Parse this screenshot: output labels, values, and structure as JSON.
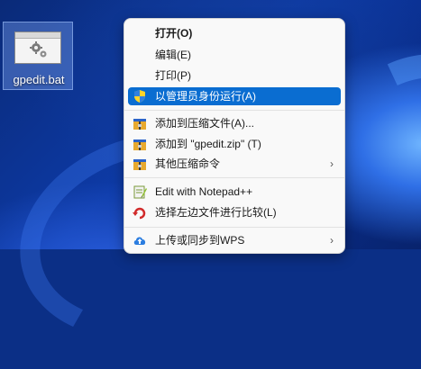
{
  "desktop": {
    "icon_label": "gpedit.bat"
  },
  "menu": {
    "items": [
      {
        "label": "打开(O)",
        "icon": "none"
      },
      {
        "label": "编辑(E)",
        "icon": "none"
      },
      {
        "label": "打印(P)",
        "icon": "none"
      },
      {
        "label": "以管理员身份运行(A)",
        "icon": "uac-shield-icon",
        "highlighted": true
      },
      {
        "label": "添加到压缩文件(A)...",
        "icon": "archive-icon"
      },
      {
        "label": "添加到 \"gpedit.zip\" (T)",
        "icon": "archive-icon"
      },
      {
        "label": "其他压缩命令",
        "icon": "archive-icon",
        "submenu": true
      },
      {
        "label": "Edit with Notepad++",
        "icon": "notepad-plus-plus-icon"
      },
      {
        "label": "选择左边文件进行比较(L)",
        "icon": "compare-icon"
      },
      {
        "label": "上传或同步到WPS",
        "icon": "cloud-upload-icon",
        "submenu": true
      }
    ],
    "submenu_arrow": "›"
  },
  "colors": {
    "highlight": "#0a6dd1",
    "menu_bg": "#f9f9f9"
  }
}
